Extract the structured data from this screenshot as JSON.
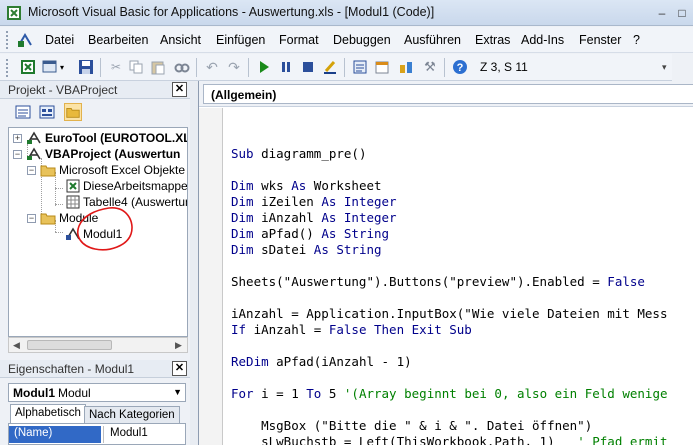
{
  "window": {
    "title": "Microsoft Visual Basic for Applications - Auswertung.xls - [Modul1 (Code)]"
  },
  "menu": {
    "items": [
      "Datei",
      "Bearbeiten",
      "Ansicht",
      "Einfügen",
      "Format",
      "Debuggen",
      "Ausführen",
      "Extras",
      "Add-Ins",
      "Fenster",
      "?"
    ]
  },
  "toolbar": {
    "cursor_position": "Z 3, S 11"
  },
  "project_panel": {
    "title": "Projekt - VBAProject",
    "tree": [
      {
        "label": "EuroTool (EUROTOOL.XL",
        "bold": true
      },
      {
        "label": "VBAProject (Auswertun",
        "bold": true
      },
      {
        "label": "Microsoft Excel Objekte",
        "bold": false
      },
      {
        "label": "DieseArbeitsmappe",
        "bold": false
      },
      {
        "label": "Tabelle4 (Auswertun",
        "bold": false
      },
      {
        "label": "Module",
        "bold": false
      },
      {
        "label": "Modul1",
        "bold": false
      }
    ]
  },
  "properties_panel": {
    "title": "Eigenschaften - Modul1",
    "object_name": "Modul1",
    "object_type": "Modul",
    "tabs": [
      "Alphabetisch",
      "Nach Kategorien"
    ],
    "prop_name": "(Name)",
    "prop_value": "Modul1"
  },
  "code_window": {
    "object_dropdown": "(Allgemein)",
    "lines": [
      {
        "parts": [
          {
            "t": "Sub ",
            "c": "kw"
          },
          {
            "t": "diagramm_pre()",
            "c": ""
          }
        ]
      },
      {
        "parts": []
      },
      {
        "parts": [
          {
            "t": "Dim ",
            "c": "kw"
          },
          {
            "t": "wks ",
            "c": ""
          },
          {
            "t": "As ",
            "c": "kw"
          },
          {
            "t": "Worksheet",
            "c": ""
          }
        ]
      },
      {
        "parts": [
          {
            "t": "Dim ",
            "c": "kw"
          },
          {
            "t": "iZeilen ",
            "c": ""
          },
          {
            "t": "As Integer",
            "c": "kw"
          }
        ]
      },
      {
        "parts": [
          {
            "t": "Dim ",
            "c": "kw"
          },
          {
            "t": "iAnzahl ",
            "c": ""
          },
          {
            "t": "As Integer",
            "c": "kw"
          }
        ]
      },
      {
        "parts": [
          {
            "t": "Dim ",
            "c": "kw"
          },
          {
            "t": "aPfad() ",
            "c": ""
          },
          {
            "t": "As String",
            "c": "kw"
          }
        ]
      },
      {
        "parts": [
          {
            "t": "Dim ",
            "c": "kw"
          },
          {
            "t": "sDatei ",
            "c": ""
          },
          {
            "t": "As String",
            "c": "kw"
          }
        ]
      },
      {
        "parts": []
      },
      {
        "parts": [
          {
            "t": "Sheets(\"Auswertung\").Buttons(\"preview\").Enabled = ",
            "c": ""
          },
          {
            "t": "False",
            "c": "kw"
          }
        ]
      },
      {
        "parts": []
      },
      {
        "parts": [
          {
            "t": "iAnzahl = Application.InputBox(\"Wie viele Dateien mit Mess",
            "c": ""
          }
        ]
      },
      {
        "parts": [
          {
            "t": "If ",
            "c": "kw"
          },
          {
            "t": "iAnzahl = ",
            "c": ""
          },
          {
            "t": "False Then Exit Sub",
            "c": "kw"
          }
        ]
      },
      {
        "parts": []
      },
      {
        "parts": [
          {
            "t": "ReDim ",
            "c": "kw"
          },
          {
            "t": "aPfad(iAnzahl - 1)",
            "c": ""
          }
        ]
      },
      {
        "parts": []
      },
      {
        "parts": [
          {
            "t": "For ",
            "c": "kw"
          },
          {
            "t": "i = 1 ",
            "c": ""
          },
          {
            "t": "To ",
            "c": "kw"
          },
          {
            "t": "5 ",
            "c": ""
          },
          {
            "t": "'(Array beginnt bei 0, also ein Feld wenige",
            "c": "cm"
          }
        ]
      },
      {
        "parts": []
      },
      {
        "parts": [
          {
            "t": "    MsgBox (\"Bitte die \" & i & \". Datei öffnen\")",
            "c": ""
          }
        ]
      },
      {
        "parts": [
          {
            "t": "    sLwBuchstb = Left(ThisWorkbook.Path, 1)   ",
            "c": ""
          },
          {
            "t": "' Pfad ermit",
            "c": "cm"
          }
        ]
      }
    ]
  }
}
